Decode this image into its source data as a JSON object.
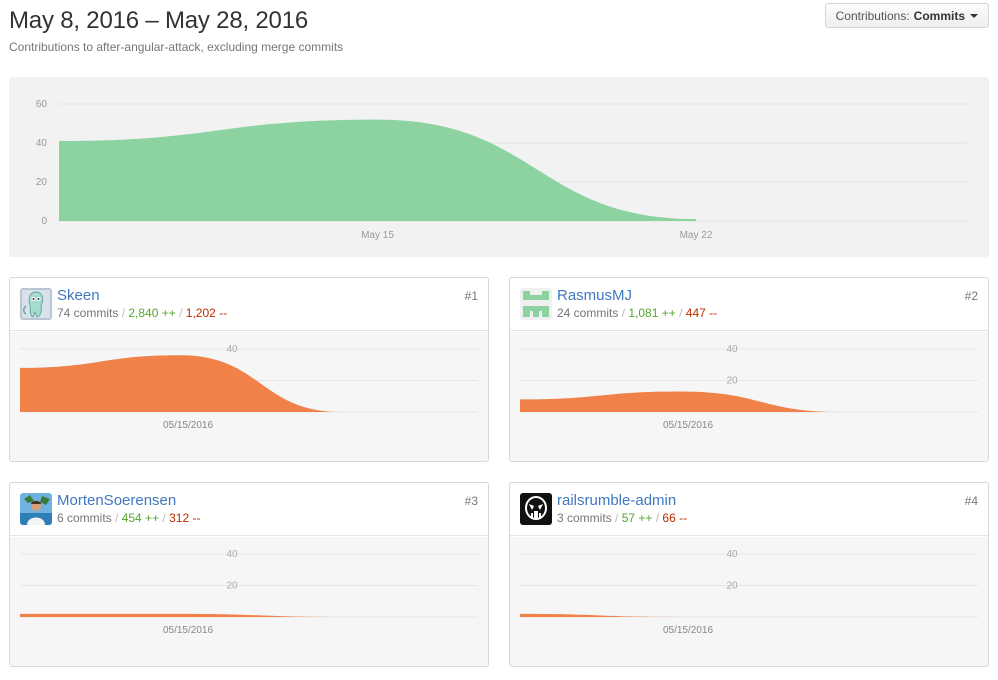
{
  "header": {
    "title": "May 8, 2016 – May 28, 2016",
    "subtitle": "Contributions to after-angular-attack, excluding merge commits"
  },
  "contributions_select": {
    "label": "Contributions:",
    "value": "Commits"
  },
  "colors": {
    "main_area": "#8cd3a1",
    "user_area": "#f08149",
    "link": "#4078c0",
    "additions": "#55a532",
    "deletions": "#bd2c00"
  },
  "chart_data": [
    {
      "type": "area",
      "x": [
        "2016-05-08",
        "2016-05-15",
        "2016-05-22"
      ],
      "y_ticks": [
        0,
        20,
        40,
        60
      ],
      "x_tick_labels": [
        "May 15",
        "May 22"
      ],
      "ylim": [
        0,
        60
      ],
      "series": [
        {
          "values": [
            41,
            52,
            1
          ]
        }
      ]
    },
    {
      "type": "area",
      "x": [
        "2016-05-08",
        "2016-05-15",
        "2016-05-22"
      ],
      "y_ticks": [
        20,
        40
      ],
      "x_tick_labels": [
        "05/15/2016"
      ],
      "ylim": [
        0,
        40
      ],
      "series": [
        {
          "name": "Skeen",
          "values": [
            28,
            36,
            0
          ]
        },
        {
          "name": "RasmusMJ",
          "values": [
            8,
            13,
            0
          ]
        },
        {
          "name": "MortenSoerensen",
          "values": [
            2,
            2,
            0
          ]
        },
        {
          "name": "railsrumble-admin",
          "values": [
            2,
            0,
            0
          ]
        }
      ]
    }
  ],
  "contributors": [
    {
      "rank": "#1",
      "name": "Skeen",
      "commits": "74 commits",
      "additions": "2,840 ++",
      "deletions": "1,202 --",
      "avatar_icon": "skeen-avatar-icon"
    },
    {
      "rank": "#2",
      "name": "RasmusMJ",
      "commits": "24 commits",
      "additions": "1,081 ++",
      "deletions": "447 --",
      "avatar_icon": "identicon-avatar-icon"
    },
    {
      "rank": "#3",
      "name": "MortenSoerensen",
      "commits": "6 commits",
      "additions": "454 ++",
      "deletions": "312 --",
      "avatar_icon": "photo-avatar-icon"
    },
    {
      "rank": "#4",
      "name": "railsrumble-admin",
      "commits": "3 commits",
      "additions": "57 ++",
      "deletions": "66 --",
      "avatar_icon": "robot-avatar-icon"
    }
  ]
}
